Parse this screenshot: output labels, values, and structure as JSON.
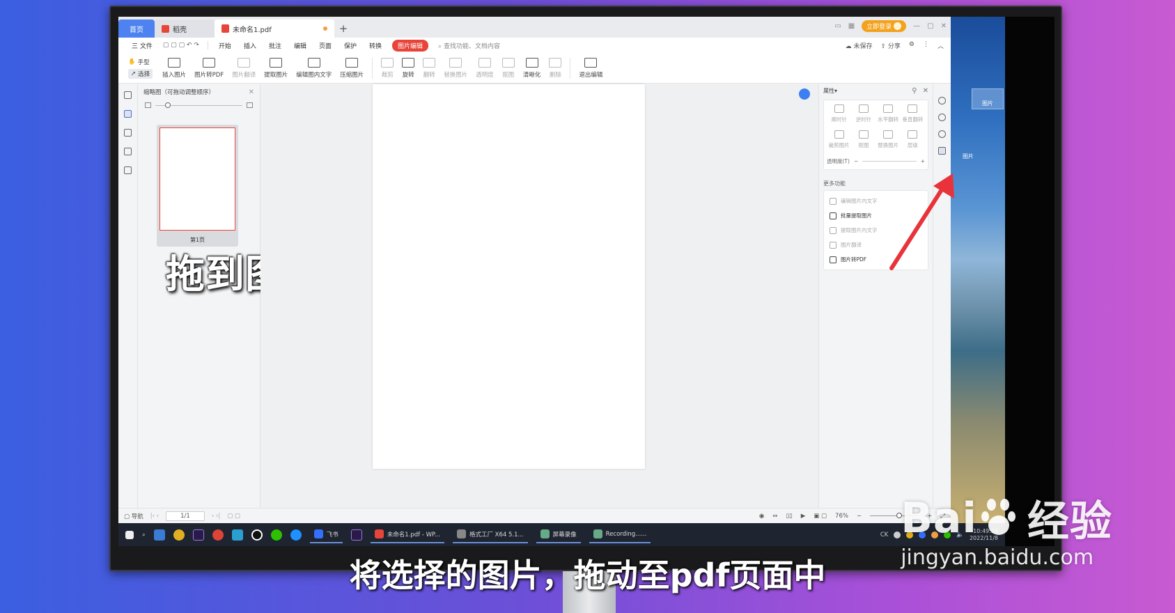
{
  "tabs": {
    "home": "首页",
    "shell": "稻壳",
    "doc": "未命名1.pdf",
    "new_tab": "+"
  },
  "titlebar": {
    "login": "立即登录"
  },
  "menu": {
    "file": "三 文件",
    "items": [
      "开始",
      "插入",
      "批注",
      "编辑",
      "页面",
      "保护",
      "转换"
    ],
    "active": "图片编辑",
    "search": "查找功能、文档内容",
    "unsaved": "未保存",
    "share": "分享"
  },
  "toolbar": {
    "hand": "手型",
    "select": "选择",
    "group1": [
      "插入图片",
      "图片转PDF",
      "图片翻译",
      "提取图片",
      "编辑图内文字",
      "压缩图片"
    ],
    "group2": [
      "裁剪",
      "旋转",
      "翻转",
      "替换图片",
      "透明度",
      "抠图",
      "清晰化",
      "删除"
    ],
    "exit": "退出编辑"
  },
  "thumbnail_panel": {
    "title": "缩略图（可拖动调整顺序）",
    "page_label": "第1页"
  },
  "overlay_caption": "拖到图片",
  "properties": {
    "title": "属性",
    "grid": [
      "顺时针",
      "逆时针",
      "水平翻转",
      "垂直翻转",
      "裁剪图片",
      "抠图",
      "替换图片",
      "层级"
    ],
    "opacity_label": "透明度(T)",
    "more_title": "更多功能",
    "more_items": [
      {
        "label": "编辑图片内文字",
        "enabled": false
      },
      {
        "label": "批量提取图片",
        "enabled": true
      },
      {
        "label": "提取图片内文字",
        "enabled": false
      },
      {
        "label": "图片翻译",
        "enabled": false
      },
      {
        "label": "图片转PDF",
        "enabled": true
      }
    ]
  },
  "statusbar": {
    "nav": "导航",
    "page": "1/1",
    "zoom": "76%"
  },
  "desktop": {
    "icon_label": "图片",
    "drag_label": "图片"
  },
  "taskbar": {
    "apps": [
      "飞书",
      "未命名1.pdf - WP...",
      "格式工厂 X64 5.1...",
      "屏幕录像",
      "Recording......"
    ],
    "tray_lang": "CK",
    "time": "10:49:24",
    "date": "2022/11/8"
  },
  "subtitle": "将选择的图片，拖动至pdf页面中",
  "watermark": {
    "brand_a": "Bai",
    "brand_b": "经验",
    "url": "jingyan.baidu.com"
  },
  "colors": {
    "accent_red": "#e8453a",
    "wps_blue": "#4d82f0",
    "arrow_red": "#e8333a"
  }
}
